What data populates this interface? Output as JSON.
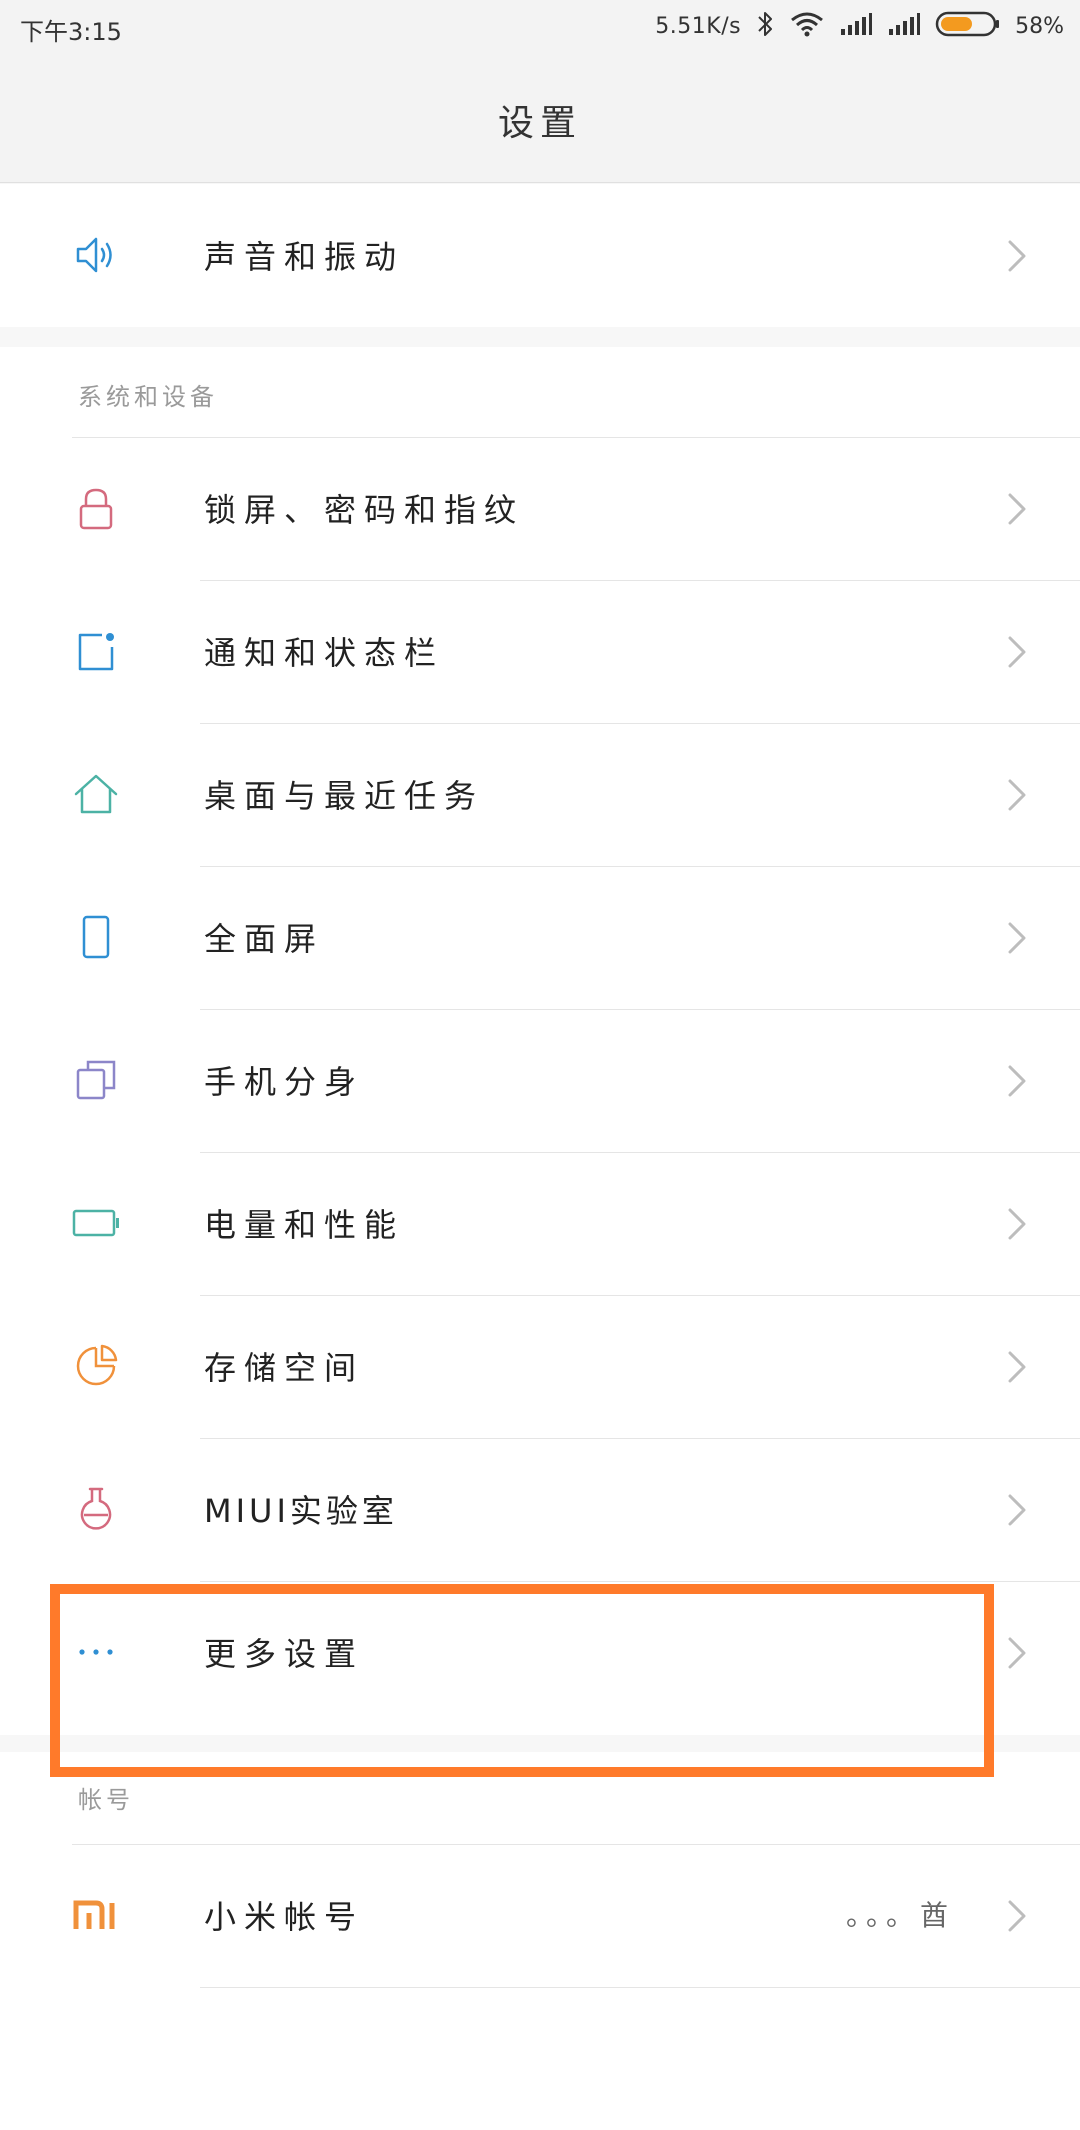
{
  "status": {
    "time": "下午3:15",
    "speed": "5.51K/s",
    "battery_percent": "58%",
    "battery_level": 0.58
  },
  "header": {
    "title": "设置"
  },
  "top": {
    "items": [
      {
        "label": "声音和振动",
        "icon": "speaker-icon"
      }
    ]
  },
  "system": {
    "title": "系统和设备",
    "items": [
      {
        "label": "锁屏、密码和指纹",
        "icon": "lock-icon"
      },
      {
        "label": "通知和状态栏",
        "icon": "notification-icon"
      },
      {
        "label": "桌面与最近任务",
        "icon": "home-icon"
      },
      {
        "label": "全面屏",
        "icon": "phone-icon"
      },
      {
        "label": "手机分身",
        "icon": "clone-icon"
      },
      {
        "label": "电量和性能",
        "icon": "battery-icon"
      },
      {
        "label": "存储空间",
        "icon": "storage-pie-icon"
      },
      {
        "label": "MIUI实验室",
        "icon": "flask-icon"
      },
      {
        "label": "更多设置",
        "icon": "more-dots-icon"
      }
    ]
  },
  "account": {
    "title": "帐号",
    "items": [
      {
        "label": "小米帐号",
        "value": "。。。酋",
        "icon": "mi-logo-icon"
      }
    ]
  },
  "colors": {
    "accent": "#2f8fd3",
    "highlight": "#ff7a2a",
    "lock": "#d46a7e",
    "teal": "#4cb2a5",
    "purple": "#8c86c9",
    "orange": "#f0913b"
  }
}
